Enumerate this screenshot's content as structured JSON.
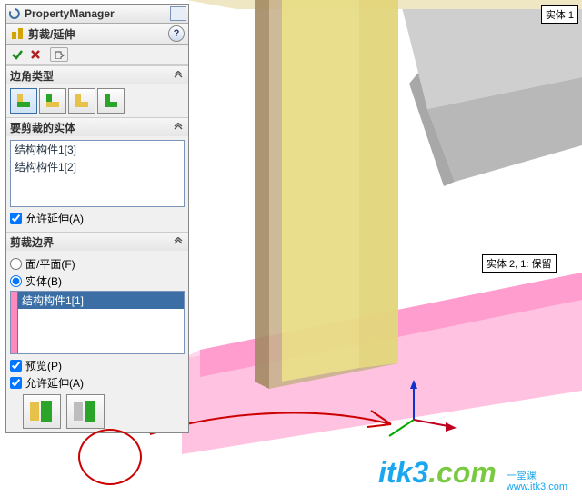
{
  "pm_title": "PropertyManager",
  "feature_name": "剪裁/延伸",
  "help_symbol": "?",
  "sections": {
    "corner": {
      "title": "边角类型"
    },
    "bodies_to_trim": {
      "title": "要剪裁的实体",
      "items": [
        "结构构件1[3]",
        "结构构件1[2]"
      ],
      "allow_extend": "允许延伸(A)",
      "allow_extend_checked": true
    },
    "boundary": {
      "title": "剪裁边界",
      "opt_face": "面/平面(F)",
      "opt_body": "实体(B)",
      "selected": "body",
      "items": [
        "结构构件1[1]"
      ],
      "preview": "预览(P)",
      "preview_checked": true,
      "allow_extend": "允许延伸(A)",
      "allow_extend_checked": true
    }
  },
  "tags": {
    "body1": "实体 1",
    "body2": "实体 2, 1: 保留"
  },
  "watermark": {
    "p1": "itk3",
    "p2": ".com",
    "sub1": "一堂课",
    "sub2": "www.itk3.com"
  }
}
